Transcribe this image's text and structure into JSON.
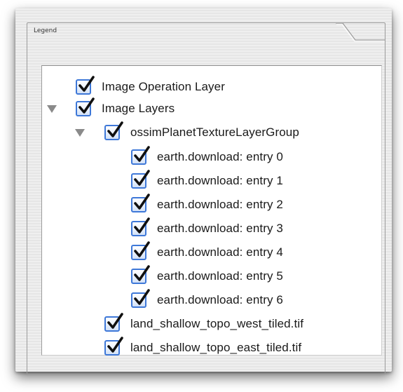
{
  "legend": {
    "title": "Legend"
  },
  "tree": {
    "items": [
      {
        "label": "Image Operation Layer",
        "checked": true,
        "expanded": null,
        "depth": 0
      },
      {
        "label": "Image Layers",
        "checked": true,
        "expanded": true,
        "depth": 0
      },
      {
        "label": "ossimPlanetTextureLayerGroup",
        "checked": true,
        "expanded": true,
        "depth": 1
      },
      {
        "label": "earth.download: entry 0",
        "checked": true,
        "expanded": null,
        "depth": 2
      },
      {
        "label": "earth.download: entry 1",
        "checked": true,
        "expanded": null,
        "depth": 2
      },
      {
        "label": "earth.download: entry 2",
        "checked": true,
        "expanded": null,
        "depth": 2
      },
      {
        "label": "earth.download: entry 3",
        "checked": true,
        "expanded": null,
        "depth": 2
      },
      {
        "label": "earth.download: entry 4",
        "checked": true,
        "expanded": null,
        "depth": 2
      },
      {
        "label": "earth.download: entry 5",
        "checked": true,
        "expanded": null,
        "depth": 2
      },
      {
        "label": "earth.download: entry 6",
        "checked": true,
        "expanded": null,
        "depth": 2
      },
      {
        "label": "land_shallow_topo_west_tiled.tif",
        "checked": true,
        "expanded": null,
        "depth": 1
      },
      {
        "label": "land_shallow_topo_east_tiled.tif",
        "checked": true,
        "expanded": null,
        "depth": 1
      }
    ]
  },
  "colors": {
    "checkbox_border": "#3e78d8",
    "checkmark": "#101010",
    "disclosure": "#8a8a8a"
  },
  "icons": {
    "checkbox": "checkbox-checked-icon",
    "disclosure_expanded": "disclosure-triangle-down-icon"
  }
}
